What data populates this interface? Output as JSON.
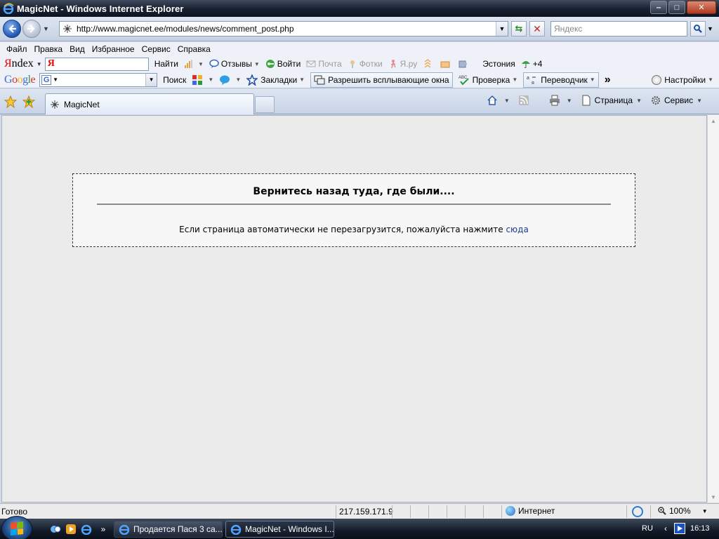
{
  "window": {
    "title": "MagicNet - Windows Internet Explorer",
    "minimize_glyph": "‒",
    "maximize_glyph": "□",
    "close_glyph": "✕"
  },
  "address_bar": {
    "url": "http://www.magicnet.ee/modules/news/comment_post.php",
    "search_placeholder": "Яндекс"
  },
  "menu": [
    "Файл",
    "Правка",
    "Вид",
    "Избранное",
    "Сервис",
    "Справка"
  ],
  "yandex_toolbar": {
    "logo_first": "Я",
    "logo_rest": "ndex",
    "input_value": "Я",
    "find_label": "Найти",
    "reviews_label": "Отзывы",
    "login_label": "Войти",
    "mail_label": "Почта",
    "photos_label": "Фотки",
    "yaru_label": "Я.ру",
    "weather_city": "Эстония",
    "weather_temp": "+4"
  },
  "google_toolbar": {
    "logo": "Google",
    "search_label": "Поиск",
    "bookmarks_label": "Закладки",
    "popups_label": "Разрешить всплывающие окна",
    "spellcheck_label": "Проверка",
    "translator_label": "Переводчик",
    "more_glyph": "»",
    "settings_label": "Настройки"
  },
  "tabs": {
    "active_title": "MagicNet",
    "page_label": "Страница",
    "tools_label": "Сервис"
  },
  "page": {
    "heading": "Вернитесь назад туда, где были....",
    "message": "Если страница автоматически не перезагрузится, пожалуйста нажмите",
    "link_text": "сюда"
  },
  "status_bar": {
    "status": "Готово",
    "ip": "217.159.171.9",
    "zone": "Интернет",
    "zoom": "100%"
  },
  "taskbar": {
    "tasks": [
      {
        "title": "Продается Пася 3 са..."
      },
      {
        "title": "MagicNet - Windows I..."
      }
    ],
    "language": "RU",
    "clock": "16:13"
  },
  "colors": {
    "link": "#1a3a8c",
    "content_bg": "#ebebeb",
    "yandex_red": "#e00000"
  }
}
